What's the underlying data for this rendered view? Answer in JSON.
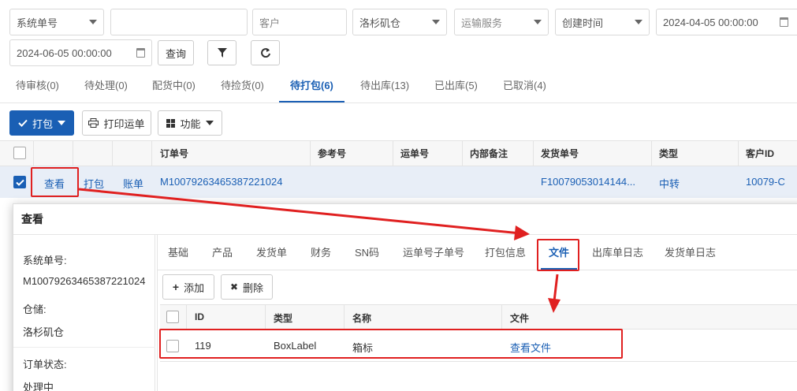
{
  "filters": {
    "system_no_select": "系统单号",
    "customer_placeholder": "客户",
    "warehouse": "洛杉矶仓",
    "shipping_service_placeholder": "运输服务",
    "created_time_select": "创建时间",
    "start_time": "2024-04-05 00:00:00",
    "end_time": "2024-06-05 00:00:00",
    "query_label": "查询"
  },
  "status_tabs": [
    {
      "label": "待审核(0)"
    },
    {
      "label": "待处理(0)"
    },
    {
      "label": "配货中(0)"
    },
    {
      "label": "待捡货(0)"
    },
    {
      "label": "待打包(6)"
    },
    {
      "label": "待出库(13)"
    },
    {
      "label": "已出库(5)"
    },
    {
      "label": "已取消(4)"
    }
  ],
  "actions": {
    "pack_label": "打包",
    "print_waybill_label": "打印运单",
    "functions_label": "功能"
  },
  "table": {
    "headers": [
      "订单号",
      "参考号",
      "运单号",
      "内部备注",
      "发货单号",
      "类型",
      "客户ID"
    ],
    "row": {
      "view": "查看",
      "pack": "打包",
      "bill": "账单",
      "order_no": "M10079263465387221024",
      "shipment_no": "F10079053014144...",
      "type": "中转",
      "customer_id": "10079-C"
    }
  },
  "modal": {
    "title": "查看",
    "sidebar": {
      "system_no_label": "系统单号:",
      "system_no_value": "M10079263465387221024",
      "warehouse_label": "仓储:",
      "warehouse_value": "洛杉矶仓",
      "order_status_label": "订单状态:",
      "order_status_value": "处理中"
    },
    "tabs": [
      {
        "label": "基础"
      },
      {
        "label": "产品"
      },
      {
        "label": "发货单"
      },
      {
        "label": "财务"
      },
      {
        "label": "SN码"
      },
      {
        "label": "运单号子单号"
      },
      {
        "label": "打包信息"
      },
      {
        "label": "文件"
      },
      {
        "label": "出库单日志"
      },
      {
        "label": "发货单日志"
      }
    ],
    "add_label": "添加",
    "delete_label": "删除",
    "file_table": {
      "headers": [
        "ID",
        "类型",
        "名称",
        "文件"
      ],
      "row": {
        "id": "119",
        "type": "BoxLabel",
        "name": "箱标",
        "file": "查看文件"
      }
    }
  },
  "colors": {
    "primary": "#1a5fb4",
    "annotation_red": "#e02020"
  }
}
